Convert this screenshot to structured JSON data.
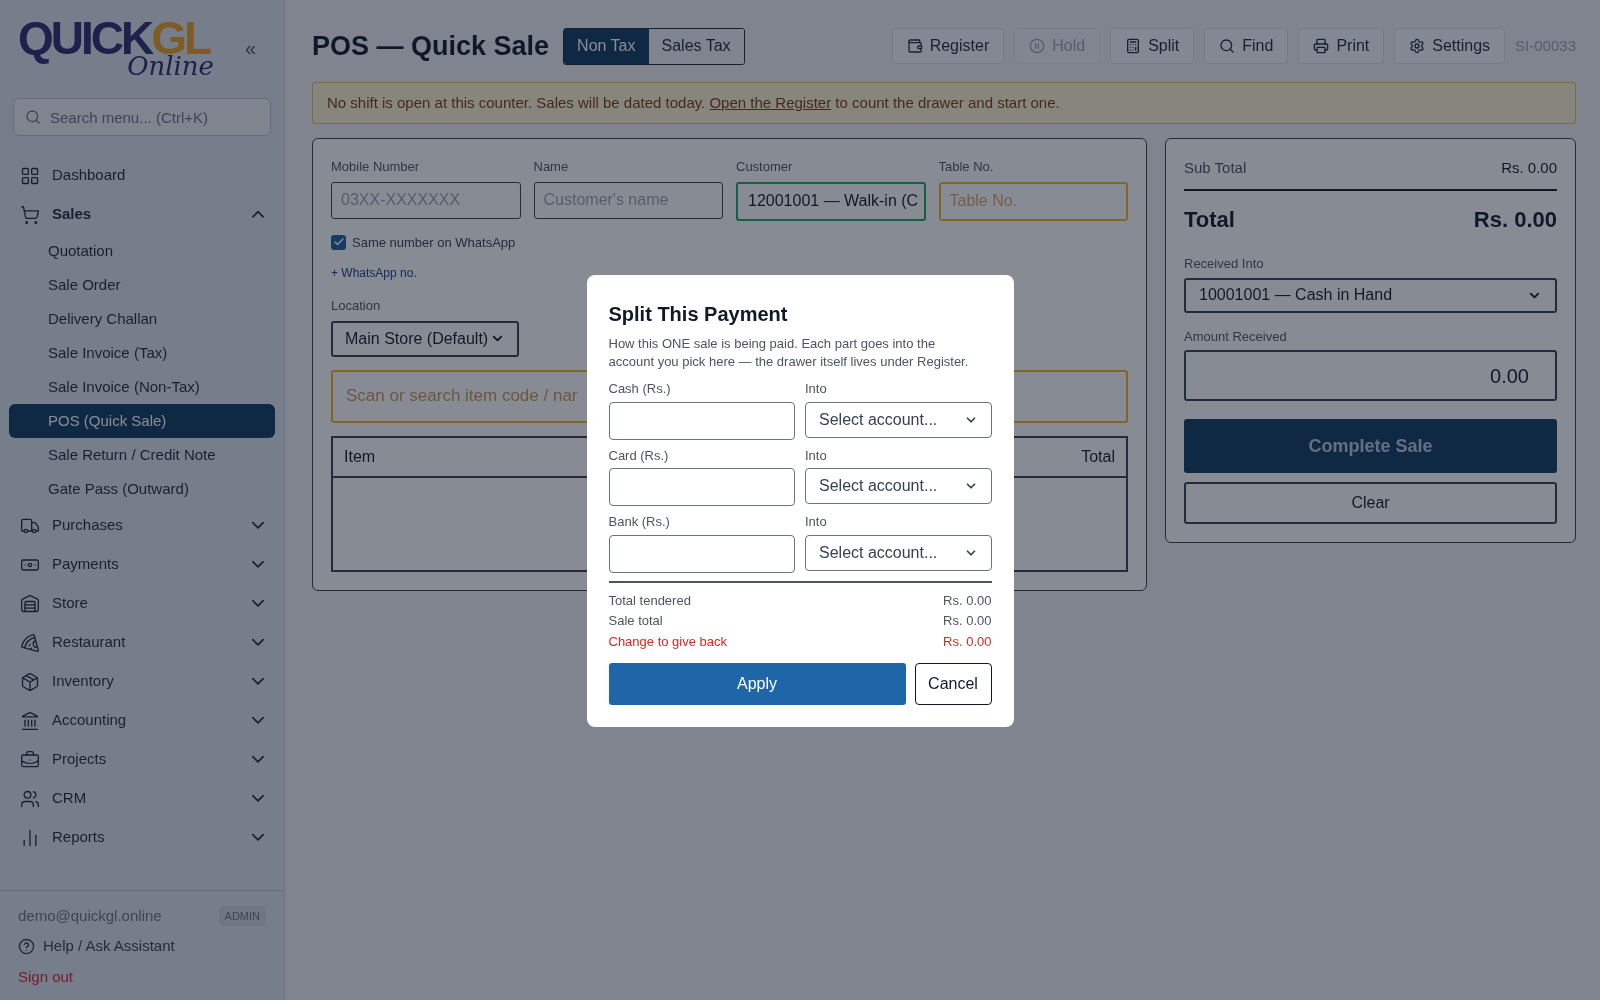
{
  "sidebar": {
    "logo": {
      "main": "QUICK",
      "accent": "GL",
      "script": "Online"
    },
    "collapse": "«",
    "search": {
      "placeholder": "Search menu... (Ctrl+K)"
    },
    "nav": [
      {
        "label": "Dashboard",
        "kind": "link"
      },
      {
        "label": "Sales",
        "kind": "group",
        "expanded": true,
        "children": [
          {
            "label": "Quotation",
            "selected": false
          },
          {
            "label": "Sale Order",
            "selected": false
          },
          {
            "label": "Delivery Challan",
            "selected": false
          },
          {
            "label": "Sale Invoice (Tax)",
            "selected": false
          },
          {
            "label": "Sale Invoice (Non-Tax)",
            "selected": false
          },
          {
            "label": "POS (Quick Sale)",
            "selected": true
          },
          {
            "label": "Sale Return / Credit Note",
            "selected": false
          },
          {
            "label": "Gate Pass (Outward)",
            "selected": false
          }
        ]
      },
      {
        "label": "Purchases",
        "kind": "group",
        "expanded": false
      },
      {
        "label": "Payments",
        "kind": "group",
        "expanded": false
      },
      {
        "label": "Store",
        "kind": "group",
        "expanded": false
      },
      {
        "label": "Restaurant",
        "kind": "group",
        "expanded": false
      },
      {
        "label": "Inventory",
        "kind": "group",
        "expanded": false
      },
      {
        "label": "Accounting",
        "kind": "group",
        "expanded": false
      },
      {
        "label": "Projects",
        "kind": "group",
        "expanded": false
      },
      {
        "label": "CRM",
        "kind": "group",
        "expanded": false
      },
      {
        "label": "Reports",
        "kind": "group",
        "expanded": false
      }
    ],
    "user": {
      "email": "demo@quickgl.online",
      "role": "ADMIN"
    },
    "help": "Help / Ask Assistant",
    "sign_out": "Sign out"
  },
  "header": {
    "title": "POS — Quick Sale",
    "tax_tabs": [
      {
        "label": "Non Tax",
        "selected": true
      },
      {
        "label": "Sales Tax",
        "selected": false
      }
    ],
    "actions": [
      {
        "label": "Register",
        "disabled": false
      },
      {
        "label": "Hold",
        "disabled": true
      },
      {
        "label": "Split",
        "disabled": false
      },
      {
        "label": "Find",
        "disabled": false
      },
      {
        "label": "Print",
        "disabled": false
      },
      {
        "label": "Settings",
        "disabled": false
      }
    ],
    "doc_number": "SI-00033"
  },
  "notice": {
    "before": "No shift is open at this counter. Sales will be dated today. ",
    "link": "Open the Register",
    "after": " to count the drawer and start one."
  },
  "sale_form": {
    "mobile": {
      "label": "Mobile Number",
      "placeholder": "03XX-XXXXXXX"
    },
    "name": {
      "label": "Name",
      "placeholder": "Customer's name"
    },
    "customer": {
      "label": "Customer",
      "value": "12001001 — Walk-in (C"
    },
    "table_no": {
      "label": "Table No.",
      "placeholder": "Table No."
    },
    "same_whatsapp": {
      "label": "Same number on WhatsApp",
      "checked": true
    },
    "add_whatsapp": "+ WhatsApp no.",
    "location": {
      "label": "Location",
      "value": "Main Store (Default)"
    },
    "item_search": {
      "placeholder": "Scan or search item code / nar"
    },
    "table": {
      "columns": [
        "Item",
        "Total"
      ]
    }
  },
  "totals": {
    "sub_total": {
      "label": "Sub Total",
      "value": "Rs. 0.00"
    },
    "total": {
      "label": "Total",
      "value": "Rs. 0.00"
    },
    "received_into": {
      "label": "Received Into",
      "value": "10001001 — Cash in Hand"
    },
    "amount_received": {
      "label": "Amount Received",
      "value": "0.00"
    },
    "complete": "Complete Sale",
    "clear": "Clear"
  },
  "dialog": {
    "title": "Split This Payment",
    "description": "How this ONE sale is being paid. Each part goes into the account you pick here — the drawer itself lives under Register.",
    "parts": [
      {
        "label": "Cash (Rs.)",
        "into_label": "Into",
        "into": "Select account..."
      },
      {
        "label": "Card (Rs.)",
        "into_label": "Into",
        "into": "Select account..."
      },
      {
        "label": "Bank (Rs.)",
        "into_label": "Into",
        "into": "Select account..."
      }
    ],
    "summary": [
      {
        "label": "Total tendered",
        "value": "Rs. 0.00",
        "kind": "plain"
      },
      {
        "label": "Sale total",
        "value": "Rs. 0.00",
        "kind": "plain"
      },
      {
        "label": "Change to give back",
        "value": "Rs. 0.00",
        "kind": "alert"
      }
    ],
    "apply": "Apply",
    "cancel": "Cancel"
  }
}
